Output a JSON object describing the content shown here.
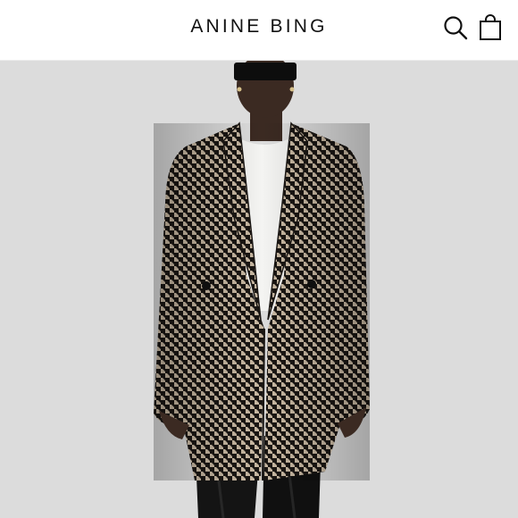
{
  "header": {
    "brand": "ANINE BING",
    "search_icon": "search-icon",
    "bag_icon": "shopping-bag-icon"
  },
  "hero": {
    "subject": "model-wearing-houndstooth-blazer",
    "background_color": "#dcdcdc",
    "blazer_colors": [
      "#1a1613",
      "#c9b9a3"
    ]
  }
}
